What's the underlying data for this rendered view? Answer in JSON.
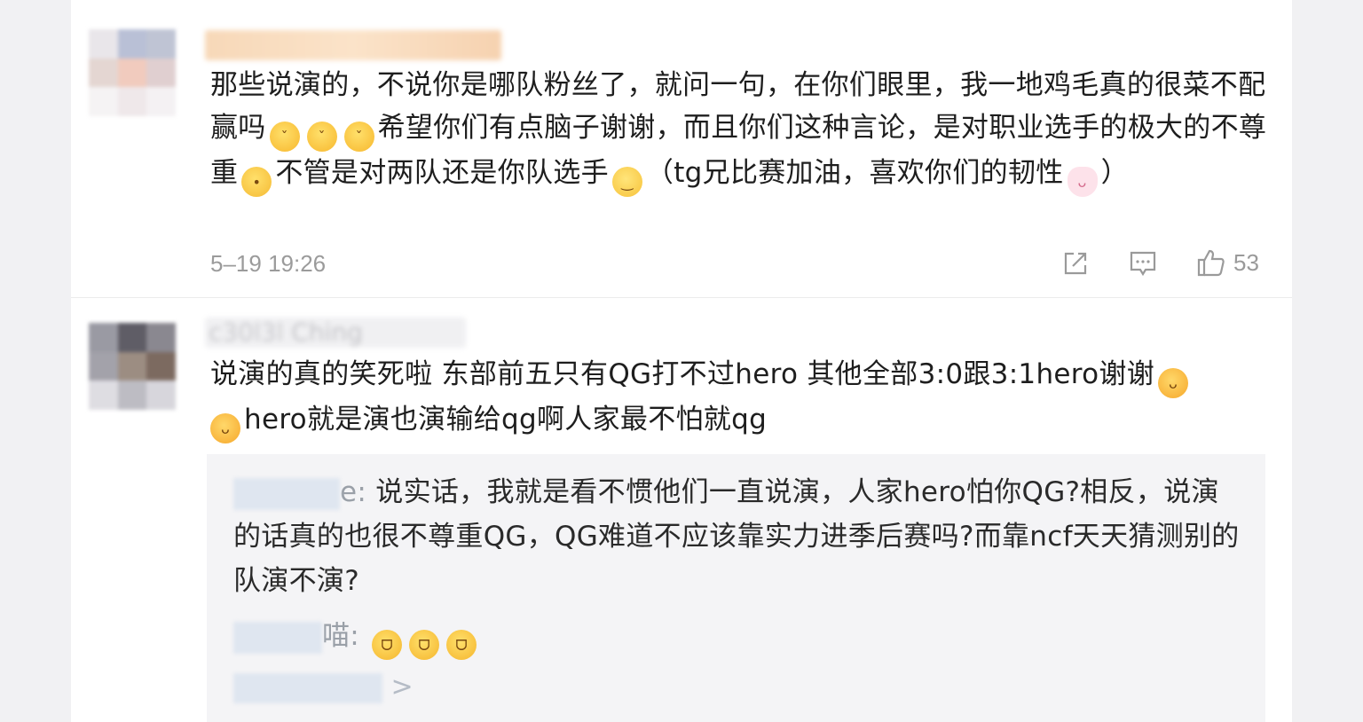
{
  "comments": [
    {
      "username": "",
      "text_parts": {
        "p1": "那些说演的，不说你是哪队粉丝了，就问一句，在你们眼里，我一地鸡毛真的很菜不配赢吗",
        "p2": "希望你们有点脑子谢谢，而且你们这种言论，是对职业选手的极大的不尊重",
        "p3": "不管是对两队还是你队选手",
        "p4": "（tg兄比赛加油，喜欢你们的韧性",
        "p5": "）"
      },
      "emojis": [
        "smirk-emoji",
        "smirk-emoji",
        "smirk-emoji",
        "thinking-emoji",
        "smile-emoji",
        "bunny-emoji"
      ],
      "timestamp": "5–19 19:26",
      "likes": "53"
    },
    {
      "username": "Ching",
      "text_parts": {
        "p1": "说演的真的笑死啦 东部前五只有QG打不过hero 其他全部3:0跟3:1hero谢谢",
        "p2": "hero就是演也演输给qg啊人家最不怕就qg"
      },
      "emojis": [
        "yum-emoji",
        "yum-emoji"
      ],
      "replies": [
        {
          "who_suffix": "e:",
          "text": " 说实话，我就是看不惯他们一直说演，人家hero怕你QG?相反，说演的话真的也很不尊重QG，QG难道不应该靠实力进季后赛吗?而靠ncf天天猜测别的队演不演?"
        },
        {
          "who_suffix": "喵:",
          "emojis": [
            "laughing-tears-emoji",
            "laughing-tears-emoji",
            "laughing-tears-emoji"
          ]
        }
      ],
      "more_suffix": ">"
    }
  ],
  "icons": {
    "share": "share-icon",
    "comment": "comment-icon",
    "like": "thumbs-up-icon"
  }
}
